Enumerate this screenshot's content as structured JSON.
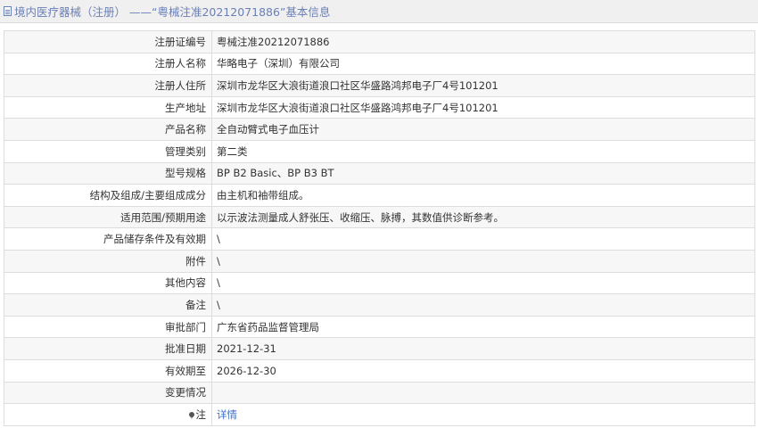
{
  "header": {
    "title": "境内医疗器械（注册） ——“粤械注准20212071886”基本信息"
  },
  "rows": [
    {
      "label": "注册证编号",
      "value": "粤械注准20212071886"
    },
    {
      "label": "注册人名称",
      "value": "华略电子（深圳）有限公司"
    },
    {
      "label": "注册人住所",
      "value": "深圳市龙华区大浪街道浪口社区华盛路鸿邦电子厂4号101201"
    },
    {
      "label": "生产地址",
      "value": "深圳市龙华区大浪街道浪口社区华盛路鸿邦电子厂4号101201"
    },
    {
      "label": "产品名称",
      "value": "全自动臂式电子血压计"
    },
    {
      "label": "管理类别",
      "value": "第二类"
    },
    {
      "label": "型号规格",
      "value": "BP B2 Basic、BP B3 BT"
    },
    {
      "label": "结构及组成/主要组成成分",
      "value": "由主机和袖带组成。"
    },
    {
      "label": "适用范围/预期用途",
      "value": "以示波法测量成人舒张压、收缩压、脉搏，其数值供诊断参考。"
    },
    {
      "label": "产品储存条件及有效期",
      "value": "\\"
    },
    {
      "label": "附件",
      "value": "\\"
    },
    {
      "label": "其他内容",
      "value": "\\"
    },
    {
      "label": "备注",
      "value": "\\"
    },
    {
      "label": "审批部门",
      "value": "广东省药品监督管理局"
    },
    {
      "label": "批准日期",
      "value": "2021-12-31"
    },
    {
      "label": "有效期至",
      "value": "2026-12-30"
    },
    {
      "label": "变更情况",
      "value": ""
    }
  ],
  "note_row": {
    "label": "注",
    "link_text": "详情",
    "icon": "pin-icon"
  },
  "colors": {
    "title_text": "#6a7fb6",
    "link": "#3c6fc9",
    "border": "#dddddd",
    "row_alt": "#f7f7f7"
  }
}
